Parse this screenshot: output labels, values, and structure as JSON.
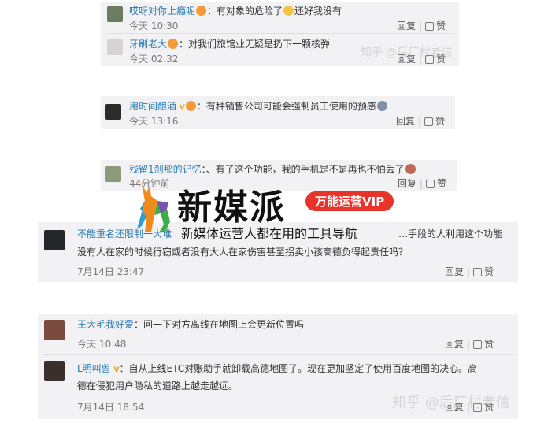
{
  "comments": [
    {
      "user": "哎呀对你上瘾呢",
      "text": "有对象的危险了",
      "text2": "还好我没有",
      "time": "今天 10:30"
    },
    {
      "user": "牙刷老大",
      "text": "对我们旅馆业无疑是扔下一颗核弹",
      "time": "今天 02:32"
    },
    {
      "user": "用时间酿酒",
      "badge": "V",
      "text": "有种销售公司可能会强制员工使用的预感",
      "time": "今天 13:16"
    },
    {
      "user": "残留1剎那的记忆",
      "text": "、有了这个功能，我的手机是不是再也不怕丢了",
      "time": "44分钟前"
    },
    {
      "user": "不能重名还限制一大堆",
      "text": "…手段的人利用这个功能",
      "text2": "没有人在家的时候行窃或者没有大人在家伤害甚至拐卖小孩高德负得起责任吗？",
      "time": "7月14日 23:47"
    },
    {
      "user": "王大毛我好爱",
      "text": "问一下对方离线在地图上会更新位置吗",
      "time": "今天 10:48"
    },
    {
      "user": "L明叫兽",
      "badge": "V",
      "text": "自从上线ETC对账助手就卸载高德地图了。现在更加坚定了使用百度地图的决心。高",
      "text2": "德在侵犯用户隐私的道路上越走越远。",
      "time": "7月14日 18:54"
    }
  ],
  "actions": {
    "reply": "回复",
    "like": "赞"
  },
  "watermarks": {
    "zhihu_top": "知乎 @后厂村老信",
    "zhihu_bottom": "知乎 @后厂村老信"
  },
  "brand": {
    "title": "新媒派",
    "badge": "万能运营VIP",
    "subtitle": "新媒体运营人都在用的工具导航"
  }
}
